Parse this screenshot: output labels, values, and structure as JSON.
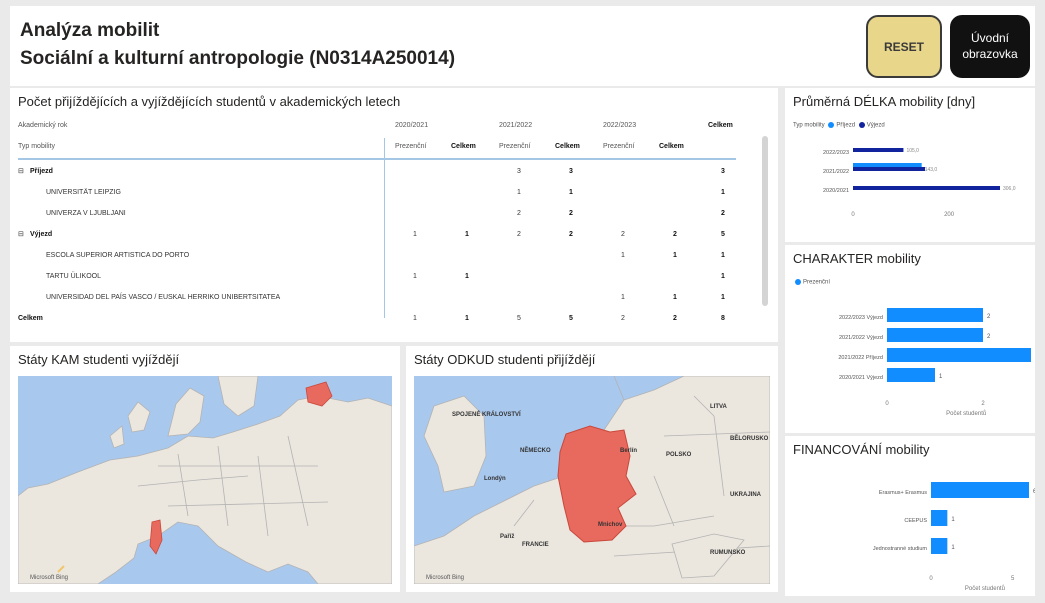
{
  "header": {
    "title": "Analýza mobilit",
    "subtitle": "Sociální a kulturní antropologie (N0314A250014)",
    "reset_label": "RESET",
    "home_label": "Úvodní obrazovka"
  },
  "table": {
    "title": "Počet přijíždějících a vyjíždějících studentů v akademických letech",
    "col_year_label": "Akademický rok",
    "col_type_label": "Typ mobility",
    "years": [
      "2020/2021",
      "2021/2022",
      "2022/2023"
    ],
    "total_label": "Celkem",
    "sub_headers": [
      "Prezenční",
      "Celkem"
    ],
    "rows": [
      {
        "label": "Příjezd",
        "indent": 0,
        "bold": true,
        "expand": "⊟",
        "cells": [
          "",
          "",
          "3",
          "3",
          "",
          "",
          "3"
        ]
      },
      {
        "label": "UNIVERSITÄT LEIPZIG",
        "indent": 1,
        "bold": false,
        "expand": "",
        "cells": [
          "",
          "",
          "1",
          "1",
          "",
          "",
          "1"
        ]
      },
      {
        "label": "UNIVERZA V LJUBLJANI",
        "indent": 1,
        "bold": false,
        "expand": "",
        "cells": [
          "",
          "",
          "2",
          "2",
          "",
          "",
          "2"
        ]
      },
      {
        "label": "Výjezd",
        "indent": 0,
        "bold": true,
        "expand": "⊟",
        "cells": [
          "1",
          "1",
          "2",
          "2",
          "2",
          "2",
          "5"
        ]
      },
      {
        "label": "ESCOLA SUPERIOR ARTISTICA DO PORTO",
        "indent": 1,
        "bold": false,
        "expand": "",
        "cells": [
          "",
          "",
          "",
          "",
          "1",
          "1",
          "1"
        ]
      },
      {
        "label": "TARTU ÜLIKOOL",
        "indent": 1,
        "bold": false,
        "expand": "",
        "cells": [
          "1",
          "1",
          "",
          "",
          "",
          "",
          "1"
        ]
      },
      {
        "label": "UNIVERSIDAD DEL PAÍS VASCO / EUSKAL HERRIKO UNIBERTSITATEA",
        "indent": 1,
        "bold": false,
        "expand": "",
        "cells": [
          "",
          "",
          "",
          "",
          "1",
          "1",
          "1"
        ]
      },
      {
        "label": "Celkem",
        "indent": 0,
        "bold": true,
        "expand": "",
        "cells": [
          "1",
          "1",
          "5",
          "5",
          "2",
          "2",
          "8"
        ]
      }
    ]
  },
  "map_left": {
    "title": "Státy KAM studenti vyjíždějí",
    "credit": "Microsoft Bing"
  },
  "map_right": {
    "title": "Státy ODKUD studenti přijíždějí",
    "credit": "Microsoft Bing",
    "labels": [
      "SPOJENÉ KRÁLOVSTVÍ",
      "LITVA",
      "POLSKO",
      "NĚMECKO",
      "BĚLORUSKO",
      "Paříž",
      "FRANCIE",
      "Londýn",
      "UKRAJINA",
      "RUMUNSKO",
      "Berlín",
      "Mnichov"
    ]
  },
  "chart_data": [
    {
      "type": "bar",
      "title": "Průměrná DÉLKA mobility [dny]",
      "legend_title": "Typ mobility",
      "categories": [
        "2022/2023",
        "2021/2022",
        "2020/2021"
      ],
      "series": [
        {
          "name": "Příjezd",
          "color": "#118dff",
          "values": [
            null,
            143,
            null
          ]
        },
        {
          "name": "Výjezd",
          "color": "#12239e",
          "values": [
            105,
            150,
            306
          ]
        }
      ],
      "data_labels": [
        "105,0",
        "143,0",
        "306,0"
      ],
      "xticks": [
        "0",
        "200"
      ],
      "xlim": [
        0,
        306
      ]
    },
    {
      "type": "bar",
      "title": "CHARAKTER mobility",
      "legend_entries": [
        "Prezenční"
      ],
      "categories": [
        "2022/2023 Výjezd",
        "2021/2022 Výjezd",
        "2021/2022 Příjezd",
        "2020/2021 Výjezd"
      ],
      "values": [
        2,
        2,
        3,
        1
      ],
      "color": "#118dff",
      "xticks": [
        "0",
        "2"
      ],
      "xlabel": "Počet studentů",
      "xlim": [
        0,
        3
      ]
    },
    {
      "type": "bar",
      "title": "FINANCOVÁNÍ mobility",
      "categories": [
        "Erasmus+ Erasmus",
        "CEEPUS",
        "Jednostranné studium"
      ],
      "values": [
        6,
        1,
        1
      ],
      "color": "#118dff",
      "xticks": [
        "0",
        "5"
      ],
      "xlabel": "Počet studentů",
      "xlim": [
        0,
        6
      ]
    }
  ]
}
